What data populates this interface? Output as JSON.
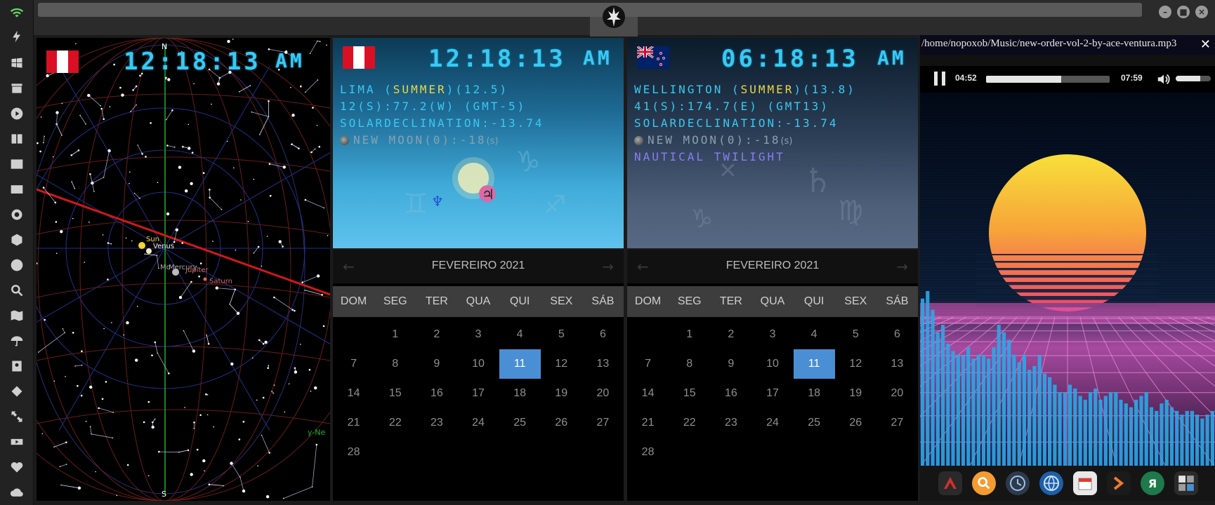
{
  "sidebar": {
    "icons": [
      "wifi-icon",
      "lightning-icon",
      "windows-icon",
      "archive-icon",
      "play-icon",
      "map-book-icon",
      "image-icon",
      "newspaper-icon",
      "settings-wheel-icon",
      "hexagon-icon",
      "globe-icon",
      "search-icon",
      "map-icon",
      "umbrella-icon",
      "contacts-icon",
      "tag-icon",
      "expand-icon",
      "youtube-icon",
      "heart-icon",
      "cloud-icon"
    ]
  },
  "skymap": {
    "time": "12:18:13",
    "ampm": "AM",
    "labels": {
      "north": "N",
      "south": "S",
      "sun": "Sun",
      "venus": "Venus",
      "mercury": "Mercury",
      "moon": "Mo",
      "jupiter": "Jupiter",
      "saturn": "Saturn",
      "edge": "y-Ne"
    }
  },
  "lima": {
    "time": "12:18:13",
    "ampm": "AM",
    "city": "LIMA",
    "season": "SUMMER",
    "temp": "(12.5)",
    "coords": "12(S):77.2(W) (GMT-5)",
    "declination": "SOLARDECLINATION:-13.74",
    "moon": "NEW MOON(0):-18",
    "moon_unit": "(s)"
  },
  "wellington": {
    "time": "06:18:13",
    "ampm": "AM",
    "city": "WELLINGTON",
    "season": "SUMMER",
    "temp": "(13.8)",
    "coords": "41(S):174.7(E) (GMT13)",
    "declination": "SOLARDECLINATION:-13.74",
    "moon": "NEW MOON(0):-18",
    "moon_unit": "(s)",
    "twilight": "NAUTICAL TWILIGHT"
  },
  "calendar": {
    "month_label": "FEVEREIRO 2021",
    "prev": "←",
    "next": "→",
    "weekdays": [
      "DOM",
      "SEG",
      "TER",
      "QUA",
      "QUI",
      "SEX",
      "SÁB"
    ],
    "today": 11,
    "weeks": [
      [
        "",
        "1",
        "2",
        "3",
        "4",
        "5",
        "6"
      ],
      [
        "7",
        "8",
        "9",
        "10",
        "11",
        "12",
        "13"
      ],
      [
        "14",
        "15",
        "16",
        "17",
        "18",
        "19",
        "20"
      ],
      [
        "21",
        "22",
        "23",
        "24",
        "25",
        "26",
        "27"
      ],
      [
        "28",
        "",
        "",
        "",
        "",
        "",
        ""
      ]
    ]
  },
  "player": {
    "path": "/home/nopoxob/Music/new-order-vol-2-by-ace-ventura.mp3",
    "close": "✕",
    "elapsed": "04:52",
    "total": "07:59",
    "progress": 0.61,
    "volume": 0.7,
    "spectrum": [
      0.45,
      0.47,
      0.42,
      0.36,
      0.38,
      0.33,
      0.31,
      0.3,
      0.3,
      0.32,
      0.29,
      0.3,
      0.3,
      0.29,
      0.32,
      0.38,
      0.36,
      0.34,
      0.3,
      0.28,
      0.3,
      0.26,
      0.27,
      0.3,
      0.25,
      0.24,
      0.22,
      0.2,
      0.2,
      0.22,
      0.21,
      0.19,
      0.18,
      0.2,
      0.21,
      0.18,
      0.19,
      0.2,
      0.2,
      0.18,
      0.17,
      0.16,
      0.18,
      0.19,
      0.2,
      0.16,
      0.15,
      0.17,
      0.18,
      0.16,
      0.15,
      0.14,
      0.15,
      0.15,
      0.14,
      0.13,
      0.14,
      0.15
    ]
  },
  "dock": {
    "icons": [
      "arch-icon",
      "search-icon",
      "clock-icon",
      "globe-icon",
      "calendar-icon",
      "terminal-arrow-icon",
      "yandex-icon",
      "calculator-icon"
    ],
    "yandex_letter": "Я"
  },
  "colors": {
    "clock_cyan": "#39c9f2",
    "season_yellow": "#e9d84a",
    "today_blue": "#4a8fd4",
    "twilight_purple": "#8a7cf5"
  }
}
